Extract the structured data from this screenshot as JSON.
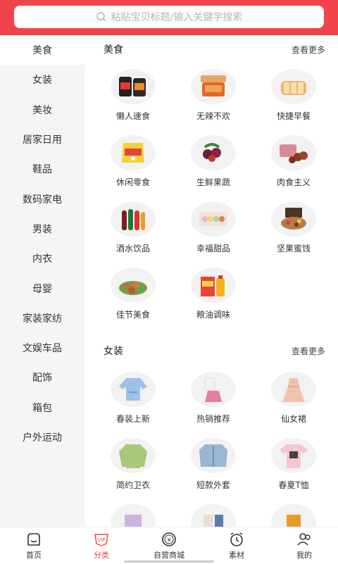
{
  "search": {
    "placeholder": "粘贴宝贝标题/输入关键字搜索"
  },
  "sidebar": {
    "items": [
      {
        "label": "美食"
      },
      {
        "label": "女装"
      },
      {
        "label": "美妆"
      },
      {
        "label": "居家日用"
      },
      {
        "label": "鞋品"
      },
      {
        "label": "数码家电"
      },
      {
        "label": "男装"
      },
      {
        "label": "内衣"
      },
      {
        "label": "母婴"
      },
      {
        "label": "家装家纺"
      },
      {
        "label": "文娱车品"
      },
      {
        "label": "配饰"
      },
      {
        "label": "箱包"
      },
      {
        "label": "户外运动"
      }
    ]
  },
  "sections": [
    {
      "title": "美食",
      "more": "查看更多",
      "items": [
        {
          "label": "懒人速食",
          "icon": "instant-noodles-icon"
        },
        {
          "label": "无辣不欢",
          "icon": "spicy-snack-icon"
        },
        {
          "label": "快捷早餐",
          "icon": "bread-icon"
        },
        {
          "label": "休闲零食",
          "icon": "snack-bag-icon"
        },
        {
          "label": "生鲜果蔬",
          "icon": "fresh-fruit-icon"
        },
        {
          "label": "肉食主义",
          "icon": "meat-icon"
        },
        {
          "label": "酒水饮品",
          "icon": "drinks-icon"
        },
        {
          "label": "幸福甜品",
          "icon": "macaron-icon"
        },
        {
          "label": "坚果蜜饯",
          "icon": "nuts-icon"
        },
        {
          "label": "佳节美食",
          "icon": "festival-food-icon"
        },
        {
          "label": "粮油调味",
          "icon": "oil-rice-icon"
        }
      ]
    },
    {
      "title": "女装",
      "more": "查看更多",
      "items": [
        {
          "label": "春装上新",
          "icon": "blouse-icon"
        },
        {
          "label": "热销推荐",
          "icon": "outfit-icon"
        },
        {
          "label": "仙女裙",
          "icon": "dress-icon"
        },
        {
          "label": "简约卫衣",
          "icon": "sweatshirt-icon"
        },
        {
          "label": "短款外套",
          "icon": "denim-jacket-icon"
        },
        {
          "label": "春夏T恤",
          "icon": "tshirt-icon"
        }
      ]
    }
  ],
  "tabs": [
    {
      "label": "首页",
      "icon": "home-icon"
    },
    {
      "label": "分类",
      "icon": "vip-icon"
    },
    {
      "label": "自营商城",
      "icon": "yuan-coin-icon"
    },
    {
      "label": "素材",
      "icon": "alarm-clock-icon"
    },
    {
      "label": "我的",
      "icon": "user-icon"
    }
  ],
  "colors": {
    "accent": "#f0434b",
    "sidebar_bg": "#f5f5f5"
  }
}
